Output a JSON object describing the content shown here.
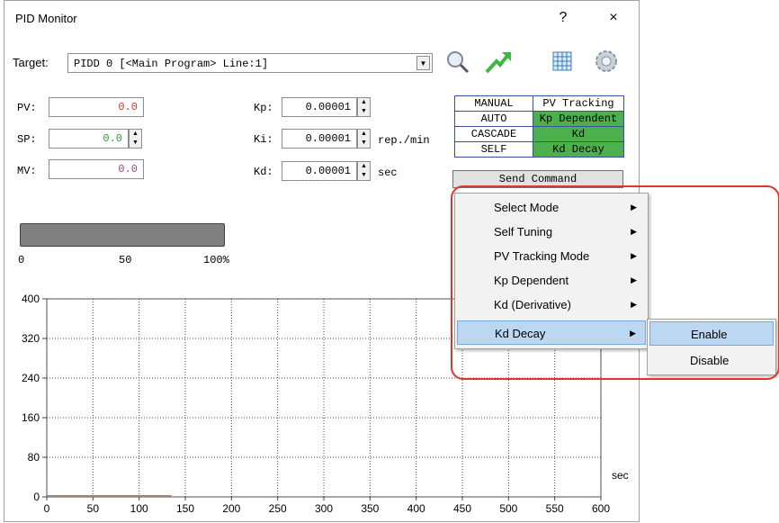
{
  "window": {
    "title": "PID Monitor",
    "help_label": "?",
    "close_label": "×"
  },
  "target": {
    "label": "Target:",
    "value": "PIDD 0 [<Main Program> Line:1]"
  },
  "icons": {
    "search": "search-icon",
    "jump": "jump-arrow-icon",
    "grid": "grid-icon",
    "settings": "gear-icon"
  },
  "values": {
    "pv_label": "PV:",
    "pv_value": "0.0",
    "sp_label": "SP:",
    "sp_value": "0.0",
    "mv_label": "MV:",
    "mv_value": "0.0",
    "kp_label": "Kp:",
    "kp_value": "0.00001",
    "ki_label": "Ki:",
    "ki_value": "0.00001",
    "ki_unit": "rep./min",
    "kd_label": "Kd:",
    "kd_value": "0.00001",
    "kd_unit": "sec"
  },
  "colors": {
    "pv": "#e0352b",
    "sp": "#2f9b2f",
    "mv": "#8a4a8a",
    "mode_on": "#4cb04c",
    "highlight": "#e0352b"
  },
  "modes": [
    {
      "left": "MANUAL",
      "right": "PV Tracking",
      "right_on": false
    },
    {
      "left": "AUTO",
      "right": "Kp Dependent",
      "right_on": true
    },
    {
      "left": "CASCADE",
      "right": "Kd",
      "right_on": true
    },
    {
      "left": "SELF",
      "right": "Kd Decay",
      "right_on": true
    }
  ],
  "send_command": "Send Command",
  "progress": {
    "value_percent": 0,
    "ticks": [
      "0",
      "50",
      "100%"
    ]
  },
  "context_menu": {
    "items": [
      "Select Mode",
      "Self Tuning",
      "PV Tracking Mode",
      "Kp Dependent",
      "Kd (Derivative)",
      "Kd Decay"
    ],
    "selected_index": 5
  },
  "submenu": {
    "items": [
      "Enable",
      "Disable"
    ],
    "selected_index": 0
  },
  "chart_data": {
    "type": "line",
    "x_ticks": [
      "0",
      "50",
      "100",
      "150",
      "200",
      "250",
      "300",
      "350",
      "400",
      "450",
      "500",
      "550",
      "600"
    ],
    "y_ticks": [
      "0",
      "80",
      "160",
      "240",
      "320",
      "400"
    ],
    "xlim": [
      0,
      600
    ],
    "ylim": [
      0,
      400
    ],
    "xlabel": "sec",
    "grid": true,
    "series": [
      {
        "x": [
          0,
          135
        ],
        "y": [
          0,
          0
        ],
        "color": "#a08070"
      }
    ]
  }
}
